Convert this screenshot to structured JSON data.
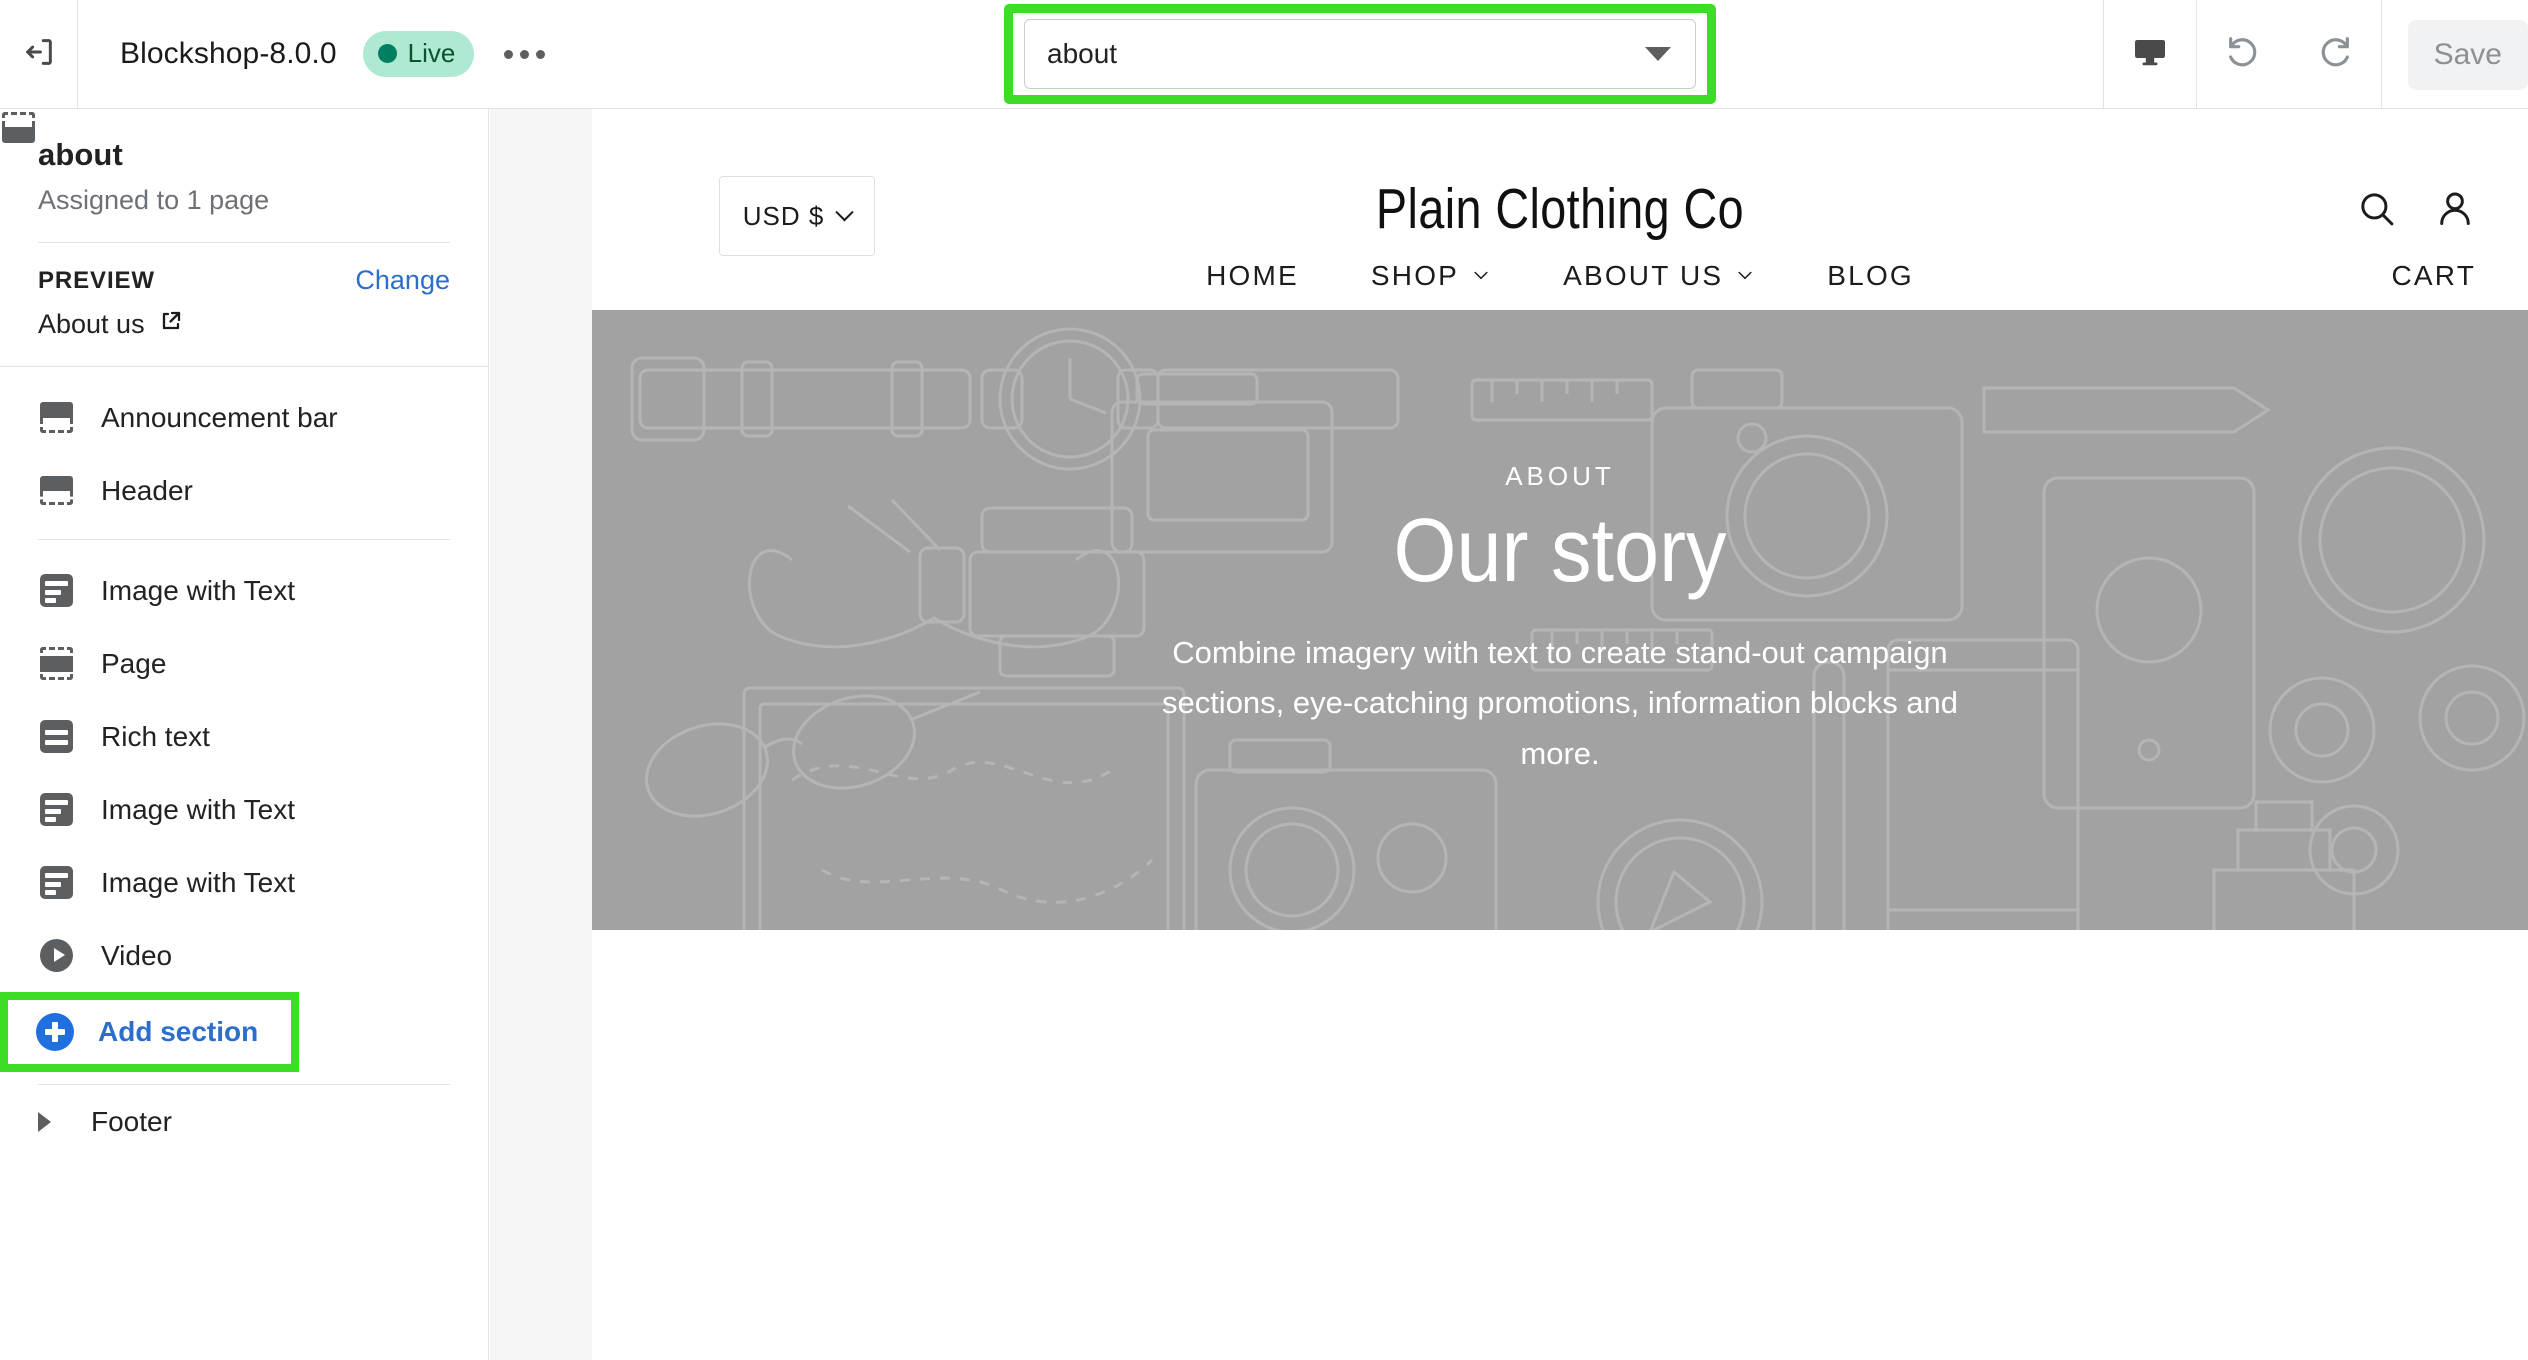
{
  "topbar": {
    "back_icon": "exit-to-left-icon",
    "theme_title": "Blockshop-8.0.0",
    "status_label": "Live",
    "more_icon": "ellipsis-icon",
    "page_selector": {
      "value": "about",
      "caret_icon": "chevron-down-icon"
    },
    "device_icon": "desktop-preview-icon",
    "undo_icon": "undo-icon",
    "redo_icon": "redo-icon",
    "save_label": "Save"
  },
  "sidebar": {
    "template_name": "about",
    "assigned_text": "Assigned to 1 page",
    "preview_label": "PREVIEW",
    "change_label": "Change",
    "preview_page": "About us",
    "external_link_icon": "external-link-icon",
    "fixed_sections": [
      {
        "label": "Announcement bar",
        "icon": "announcement-bar-icon"
      },
      {
        "label": "Header",
        "icon": "header-icon"
      }
    ],
    "sections": [
      {
        "label": "Image with Text",
        "icon": "image-with-text-icon"
      },
      {
        "label": "Page",
        "icon": "page-icon"
      },
      {
        "label": "Rich text",
        "icon": "rich-text-icon"
      },
      {
        "label": "Image with Text",
        "icon": "image-with-text-icon"
      },
      {
        "label": "Image with Text",
        "icon": "image-with-text-icon"
      },
      {
        "label": "Video",
        "icon": "video-icon"
      }
    ],
    "add_section_label": "Add section",
    "add_section_icon": "plus-circle-icon",
    "footer_label": "Footer",
    "footer_icon": "footer-icon",
    "footer_disclosure_icon": "triangle-right-icon"
  },
  "preview": {
    "currency_label": "USD $",
    "currency_caret_icon": "chevron-down-icon",
    "brand": "Plain Clothing Co",
    "search_icon": "search-icon",
    "account_icon": "account-icon",
    "nav": [
      {
        "label": "HOME",
        "has_caret": false
      },
      {
        "label": "SHOP",
        "has_caret": true
      },
      {
        "label": "ABOUT US",
        "has_caret": true
      },
      {
        "label": "BLOG",
        "has_caret": false
      }
    ],
    "cart_label": "CART",
    "hero": {
      "eyebrow": "ABOUT",
      "title": "Our story",
      "body": "Combine imagery with text to create stand-out campaign sections, eye-catching promotions, information blocks and more."
    }
  },
  "colors": {
    "annotation_green": "#3ddc26",
    "link_blue": "#2c6ecb",
    "live_green": "#008060",
    "hero_gray": "#a2a2a2"
  }
}
